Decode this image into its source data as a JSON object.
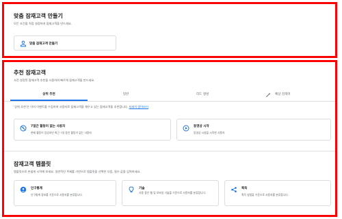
{
  "custom": {
    "title": "맞춤 잠재고객 만들기",
    "subtitle": "모든 조건을 직접 설정하여 잠재고객을 만드세요.",
    "button_label": "맞춤 잠재고객 만들기"
  },
  "recommended": {
    "title": "추천 잠재고객",
    "subtitle": "사전 설정된 잠재고객 추천을 사용하여 빠르게 잠재고객을 만드세요.",
    "tabs": [
      {
        "label": "상위 추천"
      },
      {
        "label": "일반"
      },
      {
        "label": "리드 생성"
      },
      {
        "label": "예상 검색어"
      }
    ],
    "note": "'상위 추천'은 이미 이벤트를 수집하여 사용자로 잠재고객을 채우고 있는 잠재고객을 추천합니다.",
    "note_link": "자세히 알아보기",
    "cards": [
      {
        "title": "7일간 활동이 없는 사용자",
        "desc": "한때 활동이 있었지만 최근 7일 동안 활동이 없는 사용자"
      },
      {
        "title": "동영상 시작",
        "desc": "동영상 시청을 시작한 사용자"
      }
    ]
  },
  "templates": {
    "title": "잠재고객 템플릿",
    "subtitle": "템플릿으로 손쉽게 시작해 보세요. 일반적인 주제를 기반으로 템플릿을 선택한 다음, 필수 값을 입력하세요.",
    "cards": [
      {
        "title": "인구통계",
        "desc": "인구통계 정보를 기준으로 사용자를 분류합니다."
      },
      {
        "title": "기술",
        "desc": "사용 중인 웹 및 모바일 기술을 기준으로 사용자를 분류합니다."
      },
      {
        "title": "획득",
        "desc": "획득 방법을 기준으로 사용자를 분류합니다."
      }
    ]
  },
  "colors": {
    "accent": "#1a73e8",
    "highlight_border": "#ff0000"
  }
}
